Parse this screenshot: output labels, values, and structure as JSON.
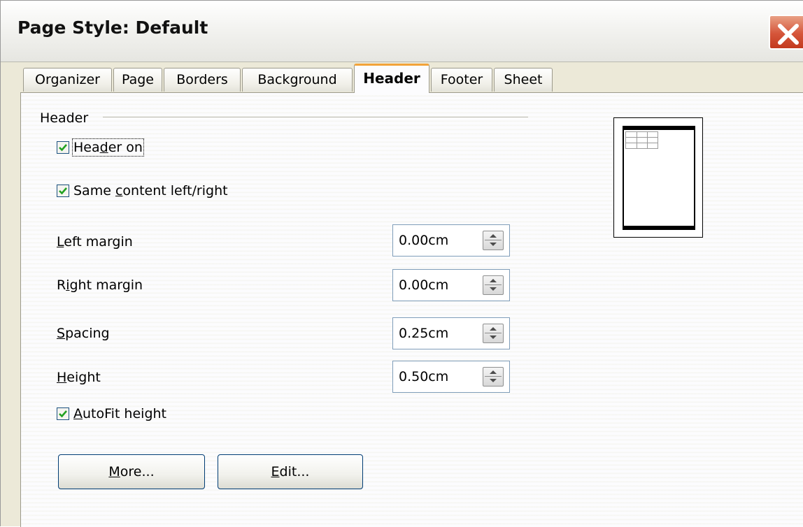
{
  "window": {
    "title": "Page Style: Default",
    "close_icon": "close-icon",
    "close_color": "#d5553a"
  },
  "tabs": [
    {
      "label": "Organizer",
      "active": false
    },
    {
      "label": "Page",
      "active": false
    },
    {
      "label": "Borders",
      "active": false
    },
    {
      "label": "Background",
      "active": false
    },
    {
      "label": "Header",
      "active": true
    },
    {
      "label": "Footer",
      "active": false
    },
    {
      "label": "Sheet",
      "active": false
    }
  ],
  "header_section": {
    "group_label": "Header",
    "header_on": {
      "label_pre": "Hea",
      "label_key": "d",
      "label_post": "er on",
      "checked": true
    },
    "same_content": {
      "label_pre": "Same ",
      "label_key": "c",
      "label_post": "ontent left/right",
      "checked": true
    },
    "fields": [
      {
        "label_key": "L",
        "label_post": "eft margin",
        "value": "0.00cm"
      },
      {
        "label_pre": "R",
        "label_key": "i",
        "label_post": "ght margin",
        "value": "0.00cm"
      },
      {
        "label_key": "S",
        "label_post": "pacing",
        "value": "0.25cm"
      },
      {
        "label_key": "H",
        "label_post": "eight",
        "value": "0.50cm"
      }
    ],
    "autofit": {
      "label_key": "A",
      "label_post": "utoFit height",
      "checked": true
    },
    "buttons": {
      "more": {
        "label_key": "M",
        "label_post": "ore..."
      },
      "edit": {
        "label_key": "E",
        "label_post": "dit..."
      }
    }
  },
  "colors": {
    "accent_tab": "#f2a33a",
    "checkmark": "#21a121",
    "button_border": "#003c74"
  }
}
